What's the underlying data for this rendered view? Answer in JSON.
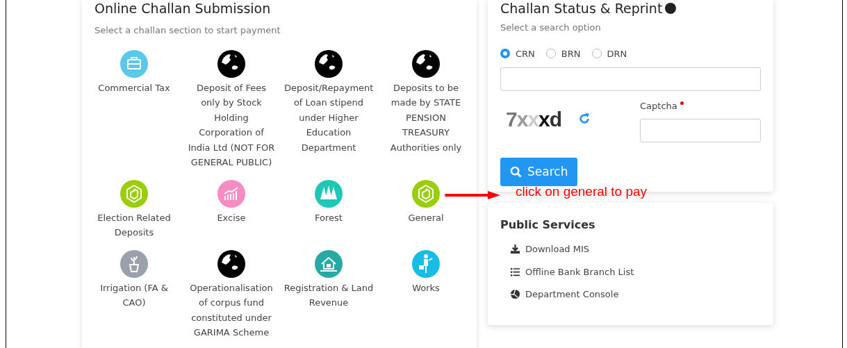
{
  "challan_submission": {
    "title": "Online Challan Submission",
    "subtitle": "Select a challan section to start payment",
    "sections": [
      {
        "label": "Commercial Tax",
        "kind": "briefcase",
        "color": "#5bc8ea"
      },
      {
        "label": "Deposit of Fees only by Stock Holding Corporation of India Ltd (NOT FOR GENERAL PUBLIC)",
        "kind": "globe",
        "color": "#000000"
      },
      {
        "label": "Deposit/Repayment of Loan stipend under Higher Education Department",
        "kind": "globe",
        "color": "#000000"
      },
      {
        "label": "Deposits to be made by STATE PENSION TREASURY Authorities only",
        "kind": "globe",
        "color": "#000000"
      },
      {
        "label": "Election Related Deposits",
        "kind": "hexagon",
        "color": "#9acd0a"
      },
      {
        "label": "Excise",
        "kind": "chart",
        "color": "#f78bc4"
      },
      {
        "label": "Forest",
        "kind": "trees",
        "color": "#1fc7b6"
      },
      {
        "label": "General",
        "kind": "hexagon",
        "color": "#9acd0a"
      },
      {
        "label": "Irrigation (FA & CAO)",
        "kind": "plant",
        "color": "#9aa1aa"
      },
      {
        "label": "Operationalisation of corpus fund constituted under GARIMA Scheme",
        "kind": "globe",
        "color": "#000000"
      },
      {
        "label": "Registration & Land Revenue",
        "kind": "house",
        "color": "#26aaa4"
      },
      {
        "label": "Works",
        "kind": "worker",
        "color": "#18bde6"
      }
    ]
  },
  "challan_status": {
    "title": "Challan Status & Reprint",
    "subtitle": "Select a search option",
    "options": [
      {
        "label": "CRN",
        "selected": true
      },
      {
        "label": "BRN",
        "selected": false
      },
      {
        "label": "DRN",
        "selected": false
      }
    ],
    "captcha_image": "7xxxd",
    "captcha_label": "Captcha",
    "search_button": "Search"
  },
  "annotation": {
    "text": "click on general to pay"
  },
  "public_services": {
    "title": "Public Services",
    "items": [
      {
        "label": "Download MIS",
        "kind": "download"
      },
      {
        "label": "Offline Bank Branch List",
        "kind": "list"
      },
      {
        "label": "Department Console",
        "kind": "console"
      }
    ]
  }
}
